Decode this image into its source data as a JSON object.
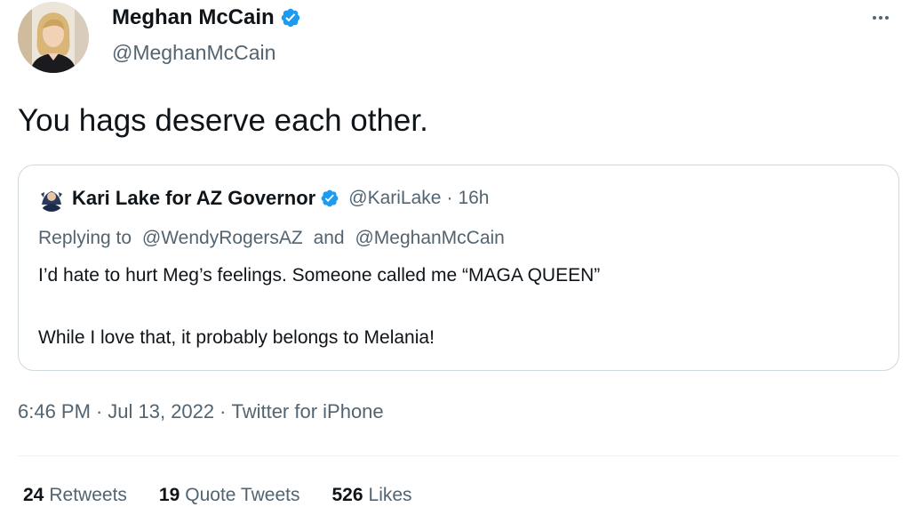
{
  "tweet": {
    "author": {
      "name": "Meghan McCain",
      "handle": "@MeghanMcCain",
      "verified": true,
      "avatar_icon": "profile-photo-avatar"
    },
    "more_icon": "more-options-icon",
    "text": "You hags deserve each other.",
    "quoted": {
      "name": "Kari Lake for AZ Governor",
      "handle": "@KariLake",
      "separator": "·",
      "time": "16h",
      "verified": true,
      "reply_prefix": "Replying to",
      "reply_to_1": "@WendyRogersAZ",
      "reply_and": "and",
      "reply_to_2": "@MeghanMcCain",
      "body_line_1": "I’d hate to hurt Meg’s feelings. Someone called me “MAGA QUEEN”",
      "body_line_2": "While I love that, it probably belongs to Melania!"
    },
    "meta": {
      "time": "6:46 PM",
      "separator": "·",
      "date": "Jul 13, 2022",
      "source": "Twitter for iPhone"
    },
    "stats": {
      "retweets_count": "24",
      "retweets_label": "Retweets",
      "quotes_count": "19",
      "quotes_label": "Quote Tweets",
      "likes_count": "526",
      "likes_label": "Likes"
    }
  },
  "colors": {
    "text_primary": "#0f1419",
    "text_secondary": "#536471",
    "verified_blue": "#1d9bf0",
    "border": "#cfd9de"
  }
}
